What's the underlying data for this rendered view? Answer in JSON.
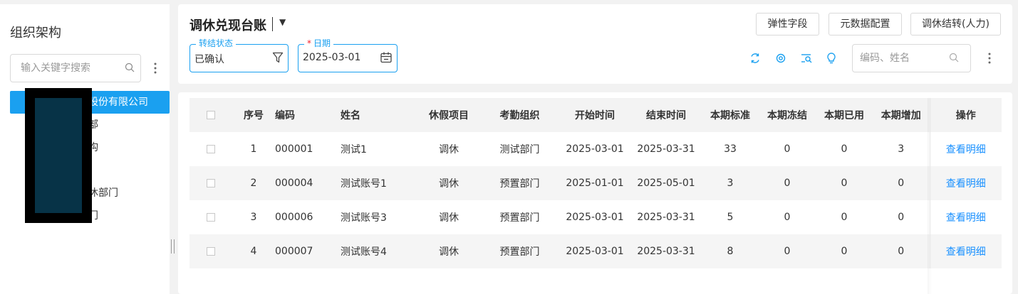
{
  "sidebar": {
    "title": "组织架构",
    "search_placeholder": "输入关键字搜索",
    "tree": [
      {
        "label": "股份有限公司",
        "active": true
      },
      {
        "label": "部",
        "active": false
      },
      {
        "label": "构",
        "active": false
      },
      {
        "label": "",
        "active": false
      },
      {
        "label": "休部门",
        "active": false
      },
      {
        "label": "门",
        "active": false
      }
    ]
  },
  "header": {
    "title": "调休兑现台账",
    "buttons": [
      "弹性字段",
      "元数据配置",
      "调休结转(人力)"
    ],
    "filters": {
      "status": {
        "label": "转结状态",
        "value": "已确认"
      },
      "date": {
        "label": "日期",
        "required_mark": "*",
        "value": "2025-03-01"
      }
    },
    "search_placeholder": "编码、姓名"
  },
  "table": {
    "columns": [
      "",
      "序号",
      "编码",
      "姓名",
      "休假项目",
      "考勤组织",
      "开始时间",
      "结束时间",
      "本期标准",
      "本期冻结",
      "本期已用",
      "本期增加",
      "操作"
    ],
    "rows": [
      {
        "seq": "1",
        "code": "000001",
        "name": "测试1",
        "leave_item": "调休",
        "org": "测试部门",
        "start": "2025-03-01",
        "end": "2025-03-31",
        "standard": "33",
        "frozen": "0",
        "used": "0",
        "added": "3",
        "action": "查看明细"
      },
      {
        "seq": "2",
        "code": "000004",
        "name": "测试账号1",
        "leave_item": "调休",
        "org": "预置部门",
        "start": "2025-01-01",
        "end": "2025-05-01",
        "standard": "3",
        "frozen": "0",
        "used": "0",
        "added": "0",
        "action": "查看明细"
      },
      {
        "seq": "3",
        "code": "000006",
        "name": "测试账号3",
        "leave_item": "调休",
        "org": "预置部门",
        "start": "2025-03-01",
        "end": "2025-03-31",
        "standard": "5",
        "frozen": "0",
        "used": "0",
        "added": "0",
        "action": "查看明细"
      },
      {
        "seq": "4",
        "code": "000007",
        "name": "测试账号4",
        "leave_item": "调休",
        "org": "预置部门",
        "start": "2025-03-01",
        "end": "2025-03-31",
        "standard": "8",
        "frozen": "0",
        "used": "0",
        "added": "0",
        "action": "查看明细"
      }
    ]
  },
  "colors": {
    "accent": "#1aa0f0",
    "link": "#1890ff",
    "redaction": "#000000",
    "redaction_inner": "#073347"
  }
}
